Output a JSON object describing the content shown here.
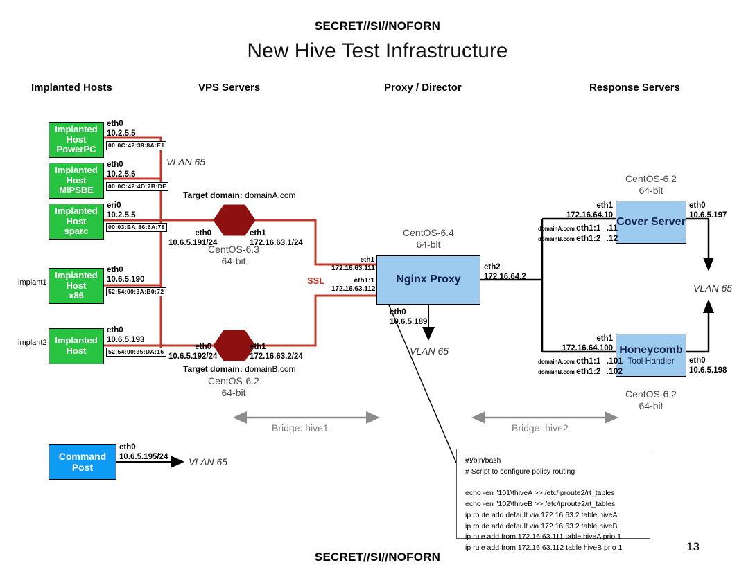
{
  "classification": {
    "top": "SECRET//SI//NOFORN",
    "bottom": "SECRET//SI//NOFORN"
  },
  "title": "New Hive Test Infrastructure",
  "page_number": "13",
  "columns": [
    {
      "label": "Implanted Hosts"
    },
    {
      "label": "VPS Servers"
    },
    {
      "label": "Proxy / Director"
    },
    {
      "label": "Response Servers"
    }
  ],
  "implanted_hosts": [
    {
      "name_line1": "Implanted",
      "name_line2": "Host",
      "name_line3": "PowerPC",
      "iface": "eth0",
      "ip": "10.2.5.5",
      "mac": "00:0C:42:39:8A:E1",
      "side_label": ""
    },
    {
      "name_line1": "Implanted",
      "name_line2": "Host",
      "name_line3": "MIPSBE",
      "iface": "eth0",
      "ip": "10.2.5.6",
      "mac": "00:0C:42:4D:7B:DE",
      "side_label": ""
    },
    {
      "name_line1": "Implanted",
      "name_line2": "Host",
      "name_line3": "sparc",
      "iface": "eri0",
      "ip": "10.2.5.5",
      "mac": "00:03:BA:86:6A:78",
      "side_label": ""
    },
    {
      "name_line1": "Implanted",
      "name_line2": "Host",
      "name_line3": "x86",
      "iface": "eth0",
      "ip": "10.6.5.190",
      "mac": "52:54:00:3A:B0:72",
      "side_label": "implant1"
    },
    {
      "name_line1": "Implanted",
      "name_line2": "Host",
      "name_line3": "",
      "iface": "eth0",
      "ip": "10.6.5.193",
      "mac": "52:54:00:35:DA:16",
      "side_label": "implant2"
    }
  ],
  "vlan_labels": {
    "left": "VLAN 65",
    "proxy": "VLAN 65",
    "right": "VLAN 65",
    "cmdpost": "VLAN 65"
  },
  "vps_servers": [
    {
      "target_domain_label": "Target domain:",
      "target_domain": "domainA.com",
      "eth0_name": "eth0",
      "eth0_ip": "10.6.5.191/24",
      "eth1_name": "eth1",
      "eth1_ip": "172.16.63.1/24",
      "os": "CentOS-6.3",
      "arch": "64-bit"
    },
    {
      "target_domain_label": "Target domain:",
      "target_domain": "domainB.com",
      "eth0_name": "eth0",
      "eth0_ip": "10.6.5.192/24",
      "eth1_name": "eth1",
      "eth1_ip": "172.16.63.2/24",
      "os": "CentOS-6.2",
      "arch": "64-bit"
    }
  ],
  "ssl_label": "SSL",
  "proxy": {
    "name": "Nginx Proxy",
    "os": "CentOS-6.4",
    "arch": "64-bit",
    "eth1_name": "eth1",
    "eth1_ip": "172.16.63.111",
    "eth1_1_name": "eth1:1",
    "eth1_1_ip": "172.16.63.112",
    "eth2_name": "eth2",
    "eth2_ip": "172.16.64.2",
    "eth0_name": "eth0",
    "eth0_ip": "10.6.5.189"
  },
  "cover_server": {
    "name": "Cover Server",
    "os": "CentOS-6.2",
    "arch": "64-bit",
    "eth1_name": "eth1",
    "eth1_ip": "172.16.64.10",
    "eth0_name": "eth0",
    "eth0_ip": "10.6.5.197",
    "aliases": [
      {
        "domain": "domainA.com",
        "iface": "eth1:1",
        "host": ".11"
      },
      {
        "domain": "domainB.com",
        "iface": "eth1:2",
        "host": ".12"
      }
    ]
  },
  "honeycomb": {
    "name": "Honeycomb",
    "subtitle": "Tool Handler",
    "os": "CentOS-6.2",
    "arch": "64-bit",
    "eth1_name": "eth1",
    "eth1_ip": "172.16.64.100",
    "eth0_name": "eth0",
    "eth0_ip": "10.6.5.198",
    "aliases": [
      {
        "domain": "domainA.com",
        "iface": "eth1:1",
        "host": ".101"
      },
      {
        "domain": "domainB.com",
        "iface": "eth1:2",
        "host": ".102"
      }
    ]
  },
  "command_post": {
    "name_line1": "Command",
    "name_line2": "Post",
    "iface": "eth0",
    "ip": "10.6.5.195/24"
  },
  "bridges": [
    {
      "label": "Bridge: hive1"
    },
    {
      "label": "Bridge: hive2"
    }
  ],
  "script_box": "#!/bin/bash\n# Script to configure policy routing\n\necho -en \"101\\thiveA >> /etc/iproute2/rt_tables\necho -en \"102\\thiveB >> /etc/iproute2/rt_tables\nip route add default via 172.16.63.2 table hiveA\nip route add default via 172.16.63.2 table hiveB\nip rule add from 172.16.63.111 table hiveA prio 1\nip rule add from 172.16.63.112 table hiveB prio 1",
  "colors": {
    "green": "#27c341",
    "blue": "#9dcbf0",
    "azure": "#0d9bf5",
    "maroon": "#8f1010",
    "ssl_red": "#c0392b",
    "bridge_gray": "#7d7d7d"
  }
}
